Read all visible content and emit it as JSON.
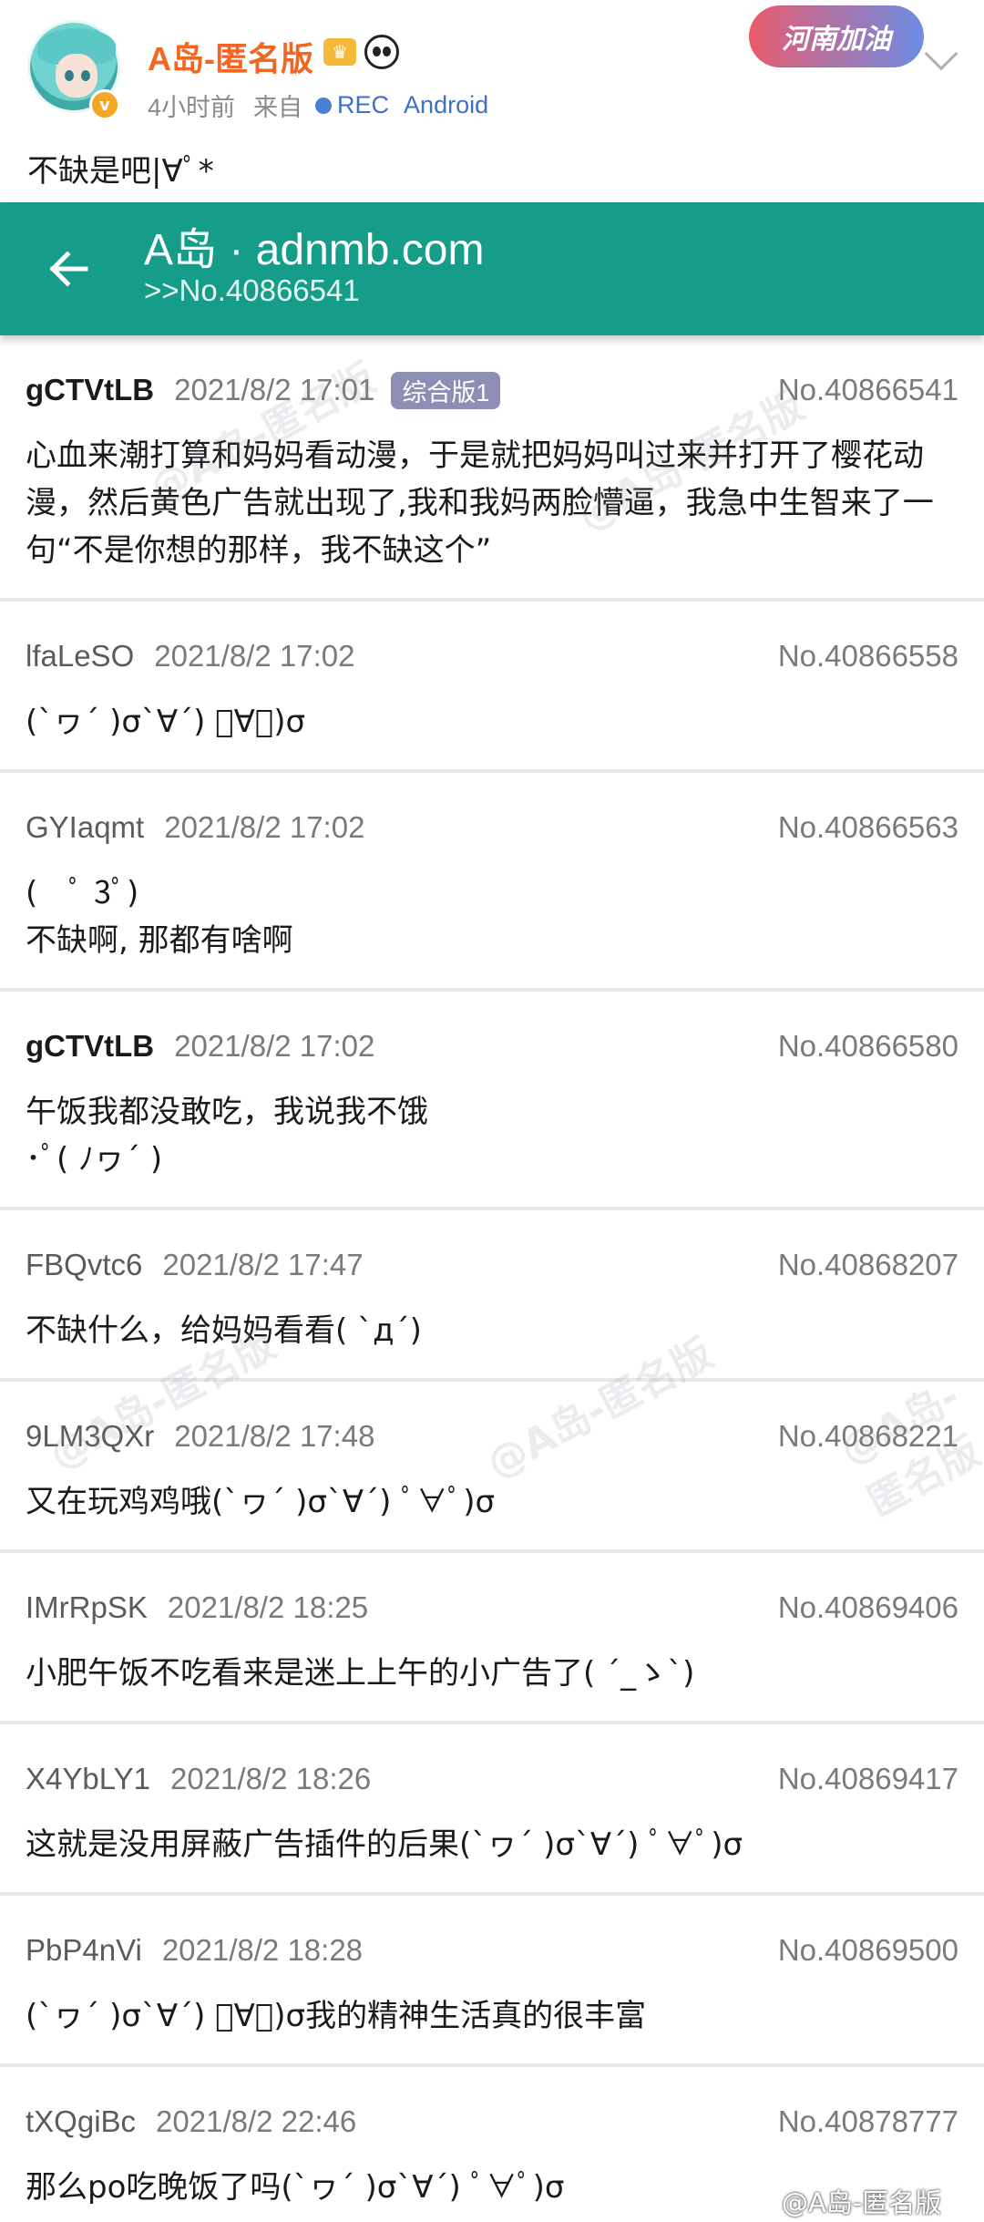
{
  "post": {
    "username": "A岛-匿名版",
    "time_ago": "4小时前",
    "source_prefix": "来自",
    "source_rec": "REC",
    "source_device": "Android",
    "banner": "河南加油",
    "text": "不缺是吧|∀ﾟ*"
  },
  "appbar": {
    "title": "A岛 · adnmb.com",
    "subtitle": ">>No.40866541"
  },
  "replies": [
    {
      "uid": "gCTVtLB",
      "po": true,
      "time": "2021/8/2 17:01",
      "badge": "综合版1",
      "no": "No.40866541",
      "text": "心血来潮打算和妈妈看动漫，于是就把妈妈叫过来并打开了樱花动漫，然后黄色广告就出现了,我和我妈两脸懵逼，我急中生智来了一句“不是你想的那样，我不缺这个”"
    },
    {
      "uid": "lfaLeSO",
      "po": false,
      "time": "2021/8/2 17:02",
      "badge": "",
      "no": "No.40866558",
      "text": "(`ヮ´ )σ`∀´) ﾟ∀ﾟ)σ"
    },
    {
      "uid": "GYIaqmt",
      "po": false,
      "time": "2021/8/2 17:02",
      "badge": "",
      "no": "No.40866563",
      "text": "(　ﾟ 3ﾟ)\n不缺啊, 那都有啥啊"
    },
    {
      "uid": "gCTVtLB",
      "po": true,
      "time": "2021/8/2 17:02",
      "badge": "",
      "no": "No.40866580",
      "text": "午饭我都没敢吃，我说我不饿\n･ﾟ( ﾉヮ´ )"
    },
    {
      "uid": "FBQvtc6",
      "po": false,
      "time": "2021/8/2 17:47",
      "badge": "",
      "no": "No.40868207",
      "text": "不缺什么，给妈妈看看( `д´)"
    },
    {
      "uid": "9LM3QXr",
      "po": false,
      "time": "2021/8/2 17:48",
      "badge": "",
      "no": "No.40868221",
      "text": "又在玩鸡鸡哦(`ヮ´ )σ`∀´) ﾟ∀ﾟ)σ"
    },
    {
      "uid": "IMrRpSK",
      "po": false,
      "time": "2021/8/2 18:25",
      "badge": "",
      "no": "No.40869406",
      "text": "小肥午饭不吃看来是迷上上午的小广告了( ´_ゝ`)"
    },
    {
      "uid": "X4YbLY1",
      "po": false,
      "time": "2021/8/2 18:26",
      "badge": "",
      "no": "No.40869417",
      "text": "这就是没用屏蔽广告插件的后果(`ヮ´ )σ`∀´) ﾟ∀ﾟ)σ"
    },
    {
      "uid": "PbP4nVi",
      "po": false,
      "time": "2021/8/2 18:28",
      "badge": "",
      "no": "No.40869500",
      "text": "(`ヮ´ )σ`∀´) ﾟ∀ﾟ)σ我的精神生活真的很丰富"
    },
    {
      "uid": "tXQgiBc",
      "po": false,
      "time": "2021/8/2 22:46",
      "badge": "",
      "no": "No.40878777",
      "text": "那么po吃晚饭了吗(`ヮ´ )σ`∀´) ﾟ∀ﾟ)σ"
    }
  ],
  "watermark": {
    "text": "@A岛-匿名版",
    "weibo": "@A岛-匿名版"
  },
  "colors": {
    "appbar": "#169d89",
    "username": "#f26522",
    "board_badge": "#8d8db5",
    "link": "#3f6fc7"
  },
  "icons": [
    "avatar",
    "verified-badge-icon",
    "crown-icon",
    "panda-icon",
    "chevron-down-icon",
    "back-arrow-icon"
  ]
}
